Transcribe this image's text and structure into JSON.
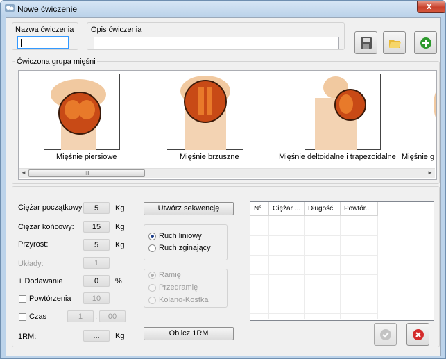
{
  "window": {
    "title": "Nowe ćwiczenie",
    "close_glyph": "x"
  },
  "header": {
    "name_label": "Nazwa ćwiczenia",
    "name_value": "",
    "desc_label": "Opis ćwiczenia",
    "desc_value": "",
    "buttons": {
      "save_icon": "floppy-icon",
      "open_icon": "folder-open-icon",
      "add_icon": "green-plus-icon"
    }
  },
  "muscle_group": {
    "label": "Ćwiczona grupa mięśni",
    "items": [
      {
        "caption": "Mięśnie piersiowe"
      },
      {
        "caption": "Mięśnie brzuszne"
      },
      {
        "caption": "Mięśnie deltoidalne i trapezoidalne"
      },
      {
        "caption": "Mięśnie g"
      }
    ],
    "scroll_left": "◄",
    "scroll_right": "►",
    "scroll_grip": "III"
  },
  "params": {
    "start_weight": {
      "label": "Ciężar początkowy:",
      "value": "5",
      "unit": "Kg"
    },
    "end_weight": {
      "label": "Ciężar końcowy:",
      "value": "15",
      "unit": "Kg"
    },
    "increment": {
      "label": "Przyrost:",
      "value": "5",
      "unit": "Kg"
    },
    "sets": {
      "label": "Układy:",
      "value": "1"
    },
    "addition": {
      "label": "+ Dodawanie",
      "value": "0",
      "unit": "%"
    },
    "repetitions": {
      "label": "Powtórzenia",
      "value": "10"
    },
    "time": {
      "label": "Czas",
      "minutes": "1",
      "separator": ":",
      "seconds": "00"
    },
    "one_rm": {
      "label": "1RM:",
      "value": "...",
      "unit": "Kg"
    }
  },
  "buttons": {
    "create_sequence": "Utwórz sekwencję",
    "calc_1rm": "Oblicz 1RM"
  },
  "movement": {
    "options": [
      {
        "label": "Ruch liniowy",
        "checked": true
      },
      {
        "label": "Ruch zginający",
        "checked": false
      }
    ]
  },
  "joint": {
    "options": [
      {
        "label": "Ramię",
        "checked": true
      },
      {
        "label": "Przedramię",
        "checked": false
      },
      {
        "label": "Kolano-Kostka",
        "checked": false
      }
    ]
  },
  "sequence_table": {
    "columns": [
      "N°",
      "Ciężar ...",
      "Długość",
      "Powtór..."
    ]
  },
  "footer": {
    "ok_icon": "check-icon",
    "cancel_icon": "cancel-icon"
  },
  "colors": {
    "accent": "#3399ff",
    "close_red": "#c8412c",
    "add_green": "#2e9a2e",
    "cancel_red": "#d42b2b"
  }
}
